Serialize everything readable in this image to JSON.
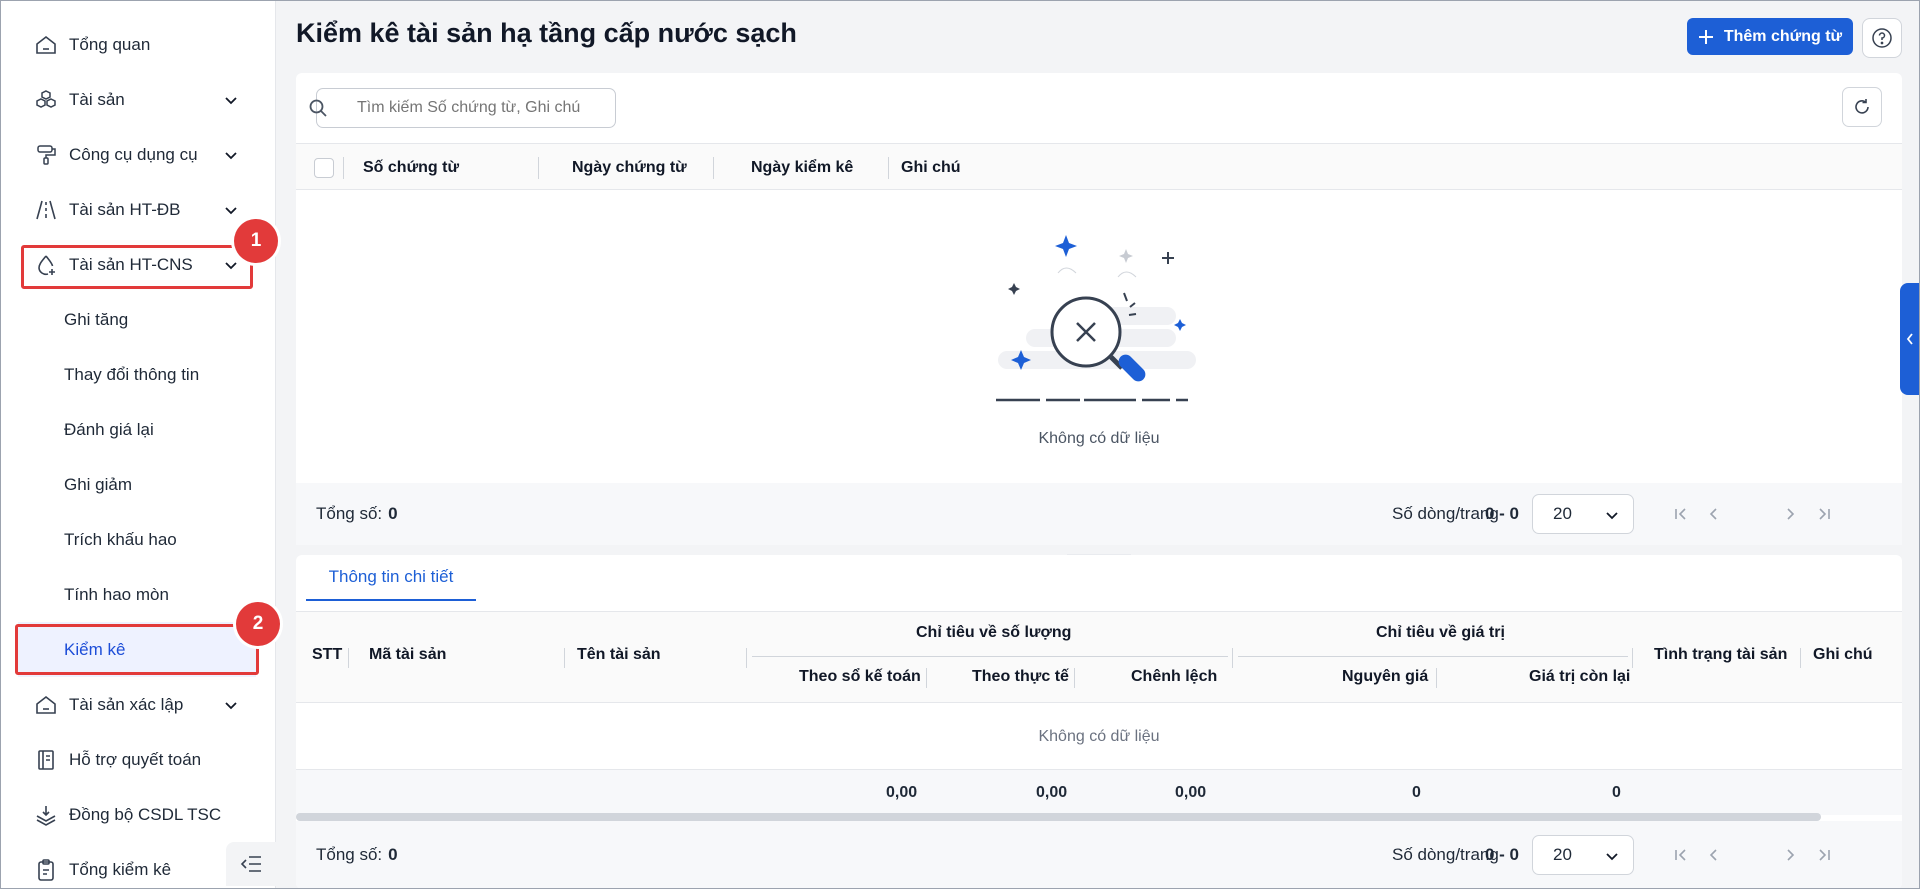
{
  "sidebar": {
    "items": [
      {
        "label": "Tổng quan",
        "icon": "home-icon"
      },
      {
        "label": "Tài sản",
        "icon": "cubes-icon"
      },
      {
        "label": "Công cụ dụng cụ",
        "icon": "paint-roller-icon"
      },
      {
        "label": "Tài sản HT-ĐB",
        "icon": "road-icon"
      },
      {
        "label": "Tài sản HT-CNS",
        "icon": "water-drop-icon"
      },
      {
        "label": "Tài sản xác lập",
        "icon": "home-icon"
      },
      {
        "label": "Hỗ trợ quyết toán",
        "icon": "ledger-icon"
      },
      {
        "label": "Đồng bộ CSDL TSC",
        "icon": "layers-sync-icon"
      },
      {
        "label": "Tổng kiểm kê",
        "icon": "clipboard-icon"
      }
    ],
    "sub_items": [
      "Ghi tăng",
      "Thay đổi thông tin",
      "Đánh giá lại",
      "Ghi giảm",
      "Trích khấu hao",
      "Tính hao mòn",
      "Kiểm kê"
    ],
    "active_sub": "Kiểm kê",
    "markers": [
      "1",
      "2"
    ]
  },
  "header": {
    "title": "Kiểm kê tài sản hạ tầng cấp nước sạch",
    "add_button": "Thêm chứng từ",
    "accent": "#1d5fd6"
  },
  "search": {
    "placeholder": "Tìm kiếm Số chứng từ, Ghi chú"
  },
  "table": {
    "columns": [
      "Số chứng từ",
      "Ngày chứng từ",
      "Ngày kiểm kê",
      "Ghi chú"
    ],
    "empty_text": "Không có dữ liệu"
  },
  "footer": {
    "total_label": "Tổng số:",
    "total_value": "0",
    "rows_label": "Số dòng/trang",
    "rows_value": "20",
    "range": "0 - 0"
  },
  "detail": {
    "tab": "Thông tin chi tiết",
    "columns": {
      "stt": "STT",
      "ma": "Mã tài sản",
      "ten": "Tên tài sản",
      "group_qty": "Chỉ tiêu về số lượng",
      "so_ke_toan": "Theo sổ kế toán",
      "thuc_te": "Theo thực tế",
      "chenh_lech": "Chênh lệch",
      "group_val": "Chỉ tiêu về giá trị",
      "nguyen_gia": "Nguyên giá",
      "con_lai": "Giá trị còn lại",
      "tinh_trang": "Tình trạng tài sản",
      "ghi_chu": "Ghi chú"
    },
    "empty_text": "Không có dữ liệu",
    "sums": {
      "so_ke_toan": "0,00",
      "thuc_te": "0,00",
      "chenh_lech": "0,00",
      "nguyen_gia": "0",
      "con_lai": "0"
    },
    "footer": {
      "total_label": "Tổng số:",
      "total_value": "0",
      "rows_label": "Số dòng/trang",
      "rows_value": "20",
      "range": "0 - 0"
    }
  }
}
